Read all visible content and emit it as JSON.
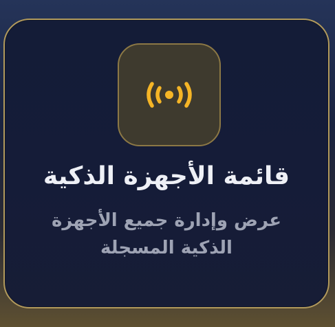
{
  "card": {
    "icon": "broadcast-signal-icon",
    "title": "قائمة الأجهزة الذكية",
    "description": "عرض وإدارة جميع الأجهزة الذكية المسجلة"
  },
  "colors": {
    "accent": "#f5b526",
    "card_border": "#b29a5c",
    "card_background": "#141c37",
    "icon_tile_background": "#3e3a2e",
    "title": "#eef0f6",
    "description": "#9ea3b4"
  }
}
